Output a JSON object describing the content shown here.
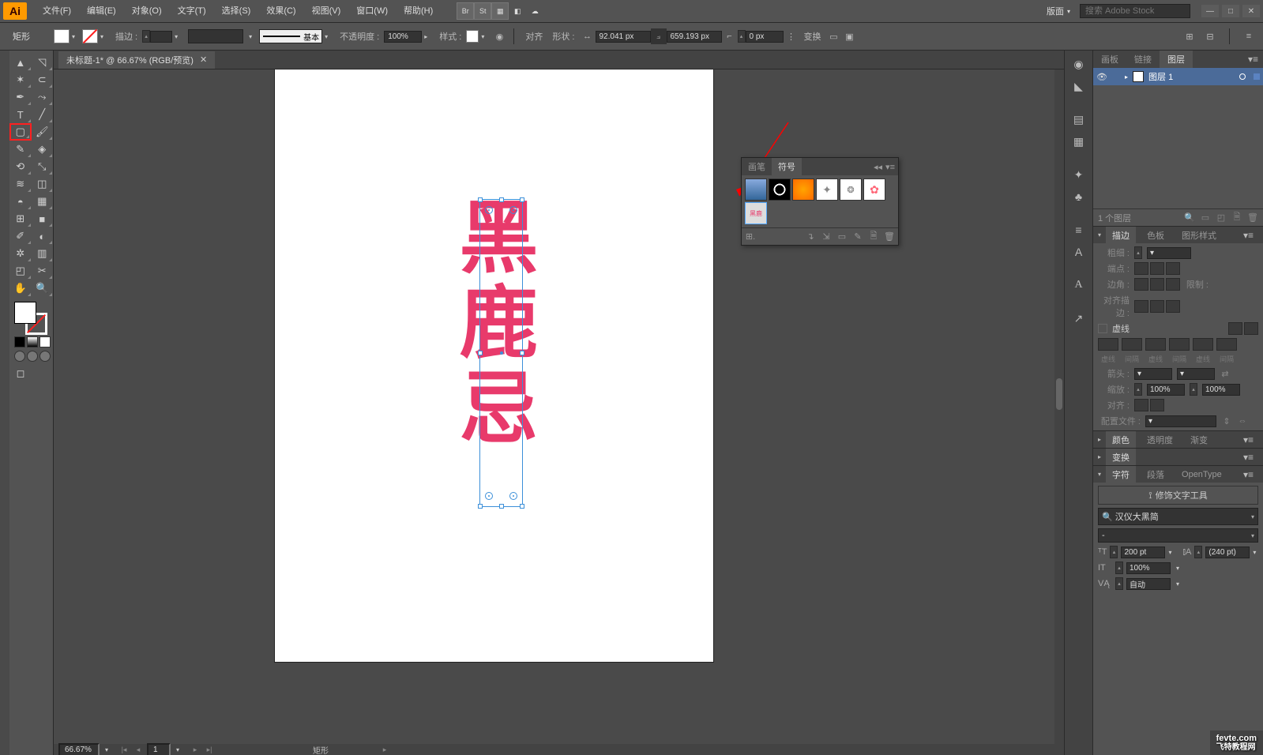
{
  "app": {
    "logo": "Ai"
  },
  "menu": {
    "file": "文件(F)",
    "edit": "编辑(E)",
    "object": "对象(O)",
    "type": "文字(T)",
    "select": "选择(S)",
    "effect": "效果(C)",
    "view": "视图(V)",
    "window": "窗口(W)",
    "help": "帮助(H)"
  },
  "menubar_icons": {
    "br": "Br",
    "st": "St"
  },
  "menubar_right": {
    "layout": "版面",
    "search_placeholder": "搜索 Adobe Stock"
  },
  "control": {
    "tool_name": "矩形",
    "stroke_label": "描边 :",
    "stroke_weight": "",
    "stroke_style": "基本",
    "opacity_label": "不透明度 :",
    "opacity": "100%",
    "style_label": "样式 :",
    "align_label": "对齐",
    "shape_label": "形状 :",
    "width": "92.041 px",
    "height": "659.193 px",
    "corner": "0 px",
    "transform_label": "变换"
  },
  "doc": {
    "tab_title": "未标题-1* @ 66.67% (RGB/预览)",
    "artboard_text": "黑鹿忌"
  },
  "statusbar": {
    "zoom": "66.67%",
    "page": "1",
    "tool": "矩形"
  },
  "symbols_panel": {
    "tab1": "画笔",
    "tab2": "符号",
    "footer_icon": "↯"
  },
  "right": {
    "layers": {
      "tab_artboards": "画板",
      "tab_links": "链接",
      "tab_layers": "图层",
      "layer1": "图层 1",
      "footer": "1 个图层"
    },
    "stroke": {
      "tab_stroke": "描边",
      "tab_swatches": "色板",
      "tab_graphic_styles": "图形样式",
      "weight_label": "粗细 :",
      "cap_label": "端点 :",
      "corner_label": "边角 :",
      "limit_label": "限制 :",
      "align_label": "对齐描边 :",
      "dash_label": "虚线",
      "dash_l1": "虚线",
      "dash_l2": "间隔",
      "dash_l3": "虚线",
      "dash_l4": "间隔",
      "dash_l5": "虚线",
      "dash_l6": "间隔",
      "arrow_label": "箭头 :",
      "scale_label": "缩放 :",
      "scale1": "100%",
      "scale2": "100%",
      "align2_label": "对齐 :",
      "profile_label": "配置文件 :"
    },
    "color": {
      "tab_color": "颜色",
      "tab_opacity": "透明度",
      "tab_gradient": "渐变"
    },
    "transform": {
      "tab": "变换"
    },
    "char": {
      "tab_char": "字符",
      "tab_para": "段落",
      "tab_ot": "OpenType",
      "touch_label": "修饰文字工具",
      "font": "汉仪大黑简",
      "font_style": "-",
      "size": "200 pt",
      "leading": "(240 pt)",
      "scale": "100%",
      "tracking": "自动"
    }
  },
  "watermark": {
    "line1": "fevte.com",
    "line2": "飞特教程网"
  }
}
